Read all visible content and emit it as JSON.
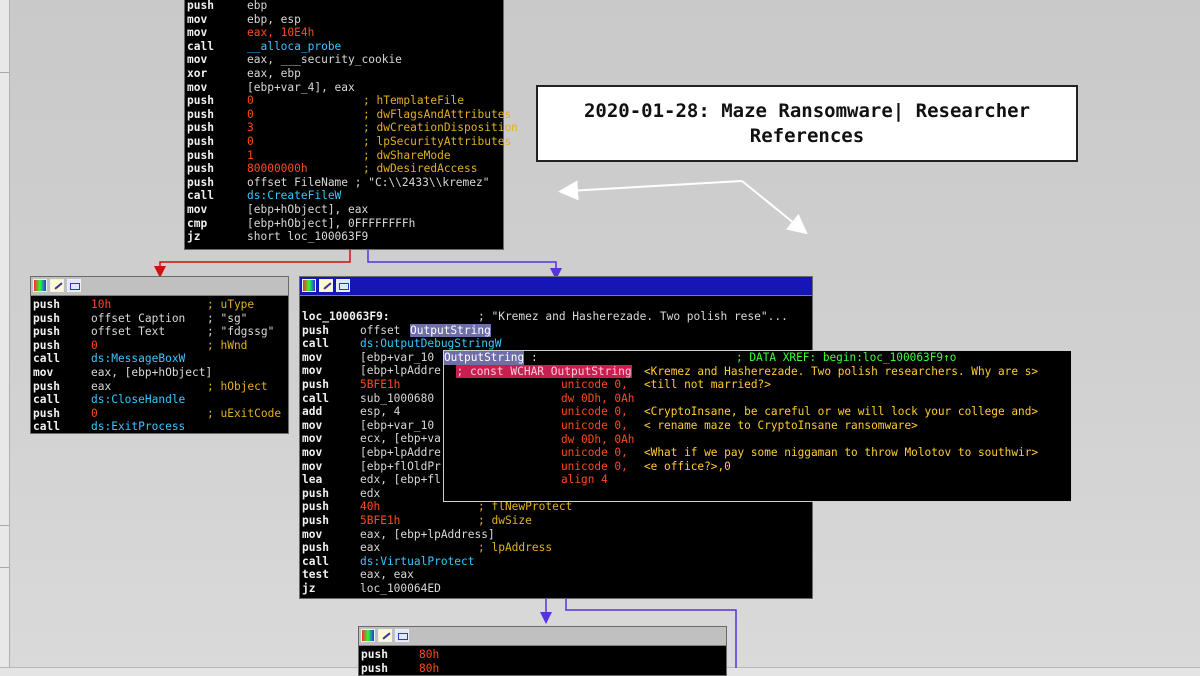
{
  "title": {
    "line1": "2020-01-28: Maze Ransomware| Researcher",
    "line2": "References"
  },
  "top_block": {
    "lines": [
      [
        [
          "mn",
          "push"
        ],
        [
          "op",
          "ebp"
        ]
      ],
      [
        [
          "mn",
          "mov"
        ],
        [
          "op",
          "ebp, esp"
        ]
      ],
      [
        [
          "mn",
          "mov"
        ],
        [
          "num",
          "eax, 10E4h"
        ]
      ],
      [
        [
          "mn",
          "call"
        ],
        [
          "sym",
          "__alloca_probe"
        ]
      ],
      [
        [
          "mn",
          "mov"
        ],
        [
          "op",
          "eax, ___security_cookie"
        ]
      ],
      [
        [
          "mn",
          "xor"
        ],
        [
          "op",
          "eax, ebp"
        ]
      ],
      [
        [
          "mn",
          "mov"
        ],
        [
          "op",
          "[ebp+var_4], eax"
        ]
      ],
      [
        [
          "mn",
          "push"
        ],
        [
          "num",
          "0"
        ],
        [
          "cm",
          "; hTemplateFile"
        ]
      ],
      [
        [
          "mn",
          "push"
        ],
        [
          "num",
          "0"
        ],
        [
          "cm",
          "; dwFlagsAndAttributes"
        ]
      ],
      [
        [
          "mn",
          "push"
        ],
        [
          "num",
          "3"
        ],
        [
          "cm",
          "; dwCreationDisposition"
        ]
      ],
      [
        [
          "mn",
          "push"
        ],
        [
          "num",
          "0"
        ],
        [
          "cm",
          "; lpSecurityAttributes"
        ]
      ],
      [
        [
          "mn",
          "push"
        ],
        [
          "num",
          "1"
        ],
        [
          "cm",
          "; dwShareMode"
        ]
      ],
      [
        [
          "mn",
          "push"
        ],
        [
          "num",
          "80000000h"
        ],
        [
          "cm",
          "; dwDesiredAccess"
        ]
      ],
      [
        [
          "mn",
          "push"
        ],
        [
          "op",
          "offset FileName ; \"C:\\\\2433\\\\kremez\""
        ]
      ],
      [
        [
          "mn",
          "call"
        ],
        [
          "sym",
          "ds:CreateFileW"
        ]
      ],
      [
        [
          "mn",
          "mov"
        ],
        [
          "op",
          "[ebp+hObject], eax"
        ]
      ],
      [
        [
          "mn",
          "cmp"
        ],
        [
          "op",
          "[ebp+hObject], 0FFFFFFFFh"
        ]
      ],
      [
        [
          "mn",
          "jz"
        ],
        [
          "op",
          "short loc_100063F9"
        ]
      ]
    ]
  },
  "left_block": {
    "lines": [
      [
        [
          "mn",
          "push"
        ],
        [
          "num",
          "10h"
        ],
        [
          "cm",
          "; uType"
        ]
      ],
      [
        [
          "mn",
          "push"
        ],
        [
          "op",
          "offset Caption"
        ],
        [
          "op",
          "; \"sg\""
        ]
      ],
      [
        [
          "mn",
          "push"
        ],
        [
          "op",
          "offset Text"
        ],
        [
          "op",
          "; \"fdgssg\""
        ]
      ],
      [
        [
          "mn",
          "push"
        ],
        [
          "num",
          "0"
        ],
        [
          "cm",
          "; hWnd"
        ]
      ],
      [
        [
          "mn",
          "call"
        ],
        [
          "sym",
          "ds:MessageBoxW"
        ]
      ],
      [
        [
          "mn",
          "mov"
        ],
        [
          "op",
          "eax, [ebp+hObject]"
        ]
      ],
      [
        [
          "mn",
          "push"
        ],
        [
          "op",
          "eax"
        ],
        [
          "cm",
          "; hObject"
        ]
      ],
      [
        [
          "mn",
          "call"
        ],
        [
          "sym",
          "ds:CloseHandle"
        ]
      ],
      [
        [
          "mn",
          "push"
        ],
        [
          "num",
          "0"
        ],
        [
          "cm",
          "; uExitCode"
        ]
      ],
      [
        [
          "mn",
          "call"
        ],
        [
          "sym",
          "ds:ExitProcess"
        ]
      ]
    ]
  },
  "right_block": {
    "label": "loc_100063F9:",
    "label_comment": "; \"Kremez and Hasherezade. Two polish rese\"...",
    "lines": [
      [
        [
          "mn",
          "push"
        ],
        [
          "op",
          "offset "
        ],
        [
          "hl",
          "OutputString"
        ]
      ],
      [
        [
          "mn",
          "call"
        ],
        [
          "sym",
          "ds:OutputDebugStringW"
        ]
      ],
      [
        [
          "mn",
          "mov"
        ],
        [
          "op",
          "[ebp+var_10"
        ]
      ],
      [
        [
          "mn",
          "mov"
        ],
        [
          "op",
          "[ebp+lpAddre"
        ]
      ],
      [
        [
          "mn",
          "push"
        ],
        [
          "num",
          "5BFE1h"
        ]
      ],
      [
        [
          "mn",
          "call"
        ],
        [
          "op",
          "sub_1000680"
        ]
      ],
      [
        [
          "mn",
          "add"
        ],
        [
          "op",
          "esp, 4"
        ]
      ],
      [
        [
          "mn",
          "mov"
        ],
        [
          "op",
          "[ebp+var_10"
        ]
      ],
      [
        [
          "mn",
          "mov"
        ],
        [
          "op",
          "ecx, [ebp+va"
        ]
      ],
      [
        [
          "mn",
          "mov"
        ],
        [
          "op",
          "[ebp+lpAddre"
        ]
      ],
      [
        [
          "mn",
          "mov"
        ],
        [
          "op",
          "[ebp+flOldPr"
        ]
      ],
      [
        [
          "mn",
          "lea"
        ],
        [
          "op",
          "edx, [ebp+fl"
        ]
      ],
      [
        [
          "mn",
          "push"
        ],
        [
          "op",
          "edx"
        ]
      ],
      [
        [
          "mn",
          "push"
        ],
        [
          "num",
          "40h"
        ],
        [
          "cm",
          "; flNewProtect"
        ]
      ],
      [
        [
          "mn",
          "push"
        ],
        [
          "num",
          "5BFE1h"
        ],
        [
          "cm",
          "; dwSize"
        ]
      ],
      [
        [
          "mn",
          "mov"
        ],
        [
          "op",
          "eax, [ebp+lpAddress]"
        ]
      ],
      [
        [
          "mn",
          "push"
        ],
        [
          "op",
          "eax"
        ],
        [
          "cm",
          "; lpAddress"
        ]
      ],
      [
        [
          "mn",
          "call"
        ],
        [
          "sym",
          "ds:VirtualProtect"
        ]
      ],
      [
        [
          "mn",
          "test"
        ],
        [
          "op",
          "eax, eax"
        ]
      ],
      [
        [
          "mn",
          "jz"
        ],
        [
          "op",
          "loc_100064ED"
        ]
      ]
    ]
  },
  "bottom_block": {
    "lines": [
      [
        [
          "mn",
          "push"
        ],
        [
          "num",
          "80h"
        ]
      ],
      [
        [
          "mn",
          "push"
        ],
        [
          "num",
          "80h"
        ]
      ]
    ]
  },
  "popup": {
    "header_prefix": "; const WCHAR ",
    "header_symbol": "OutputString",
    "symbol": "OutputString",
    "symbol_colon": ":",
    "xref": "; DATA XREF: begin:loc_100063F9↑o",
    "rows": [
      [
        "unicode 0,",
        "<Kremez and Hasherezade. Two polish researchers. Why are s>"
      ],
      [
        "unicode 0,",
        "<till not married?>"
      ],
      [
        "dw 0Dh, 0Ah",
        ""
      ],
      [
        "unicode 0,",
        "<CryptoInsane, be careful or we will lock your college and>"
      ],
      [
        "unicode 0,",
        "< rename maze to CryptoInsane ransomware>"
      ],
      [
        "dw 0Dh, 0Ah",
        ""
      ],
      [
        "unicode 0,",
        "<What if we pay some niggaman to throw Molotov to southwir>"
      ],
      [
        "unicode 0,",
        "<e office?>,0"
      ],
      [
        "align 4",
        ""
      ]
    ]
  },
  "colors": {
    "edge_red": "#cc1111",
    "edge_blue": "#5533dd",
    "window_blue": "#1616b8"
  },
  "icons": [
    "graph-color-icon",
    "edit-pencil-icon",
    "window-icon"
  ]
}
